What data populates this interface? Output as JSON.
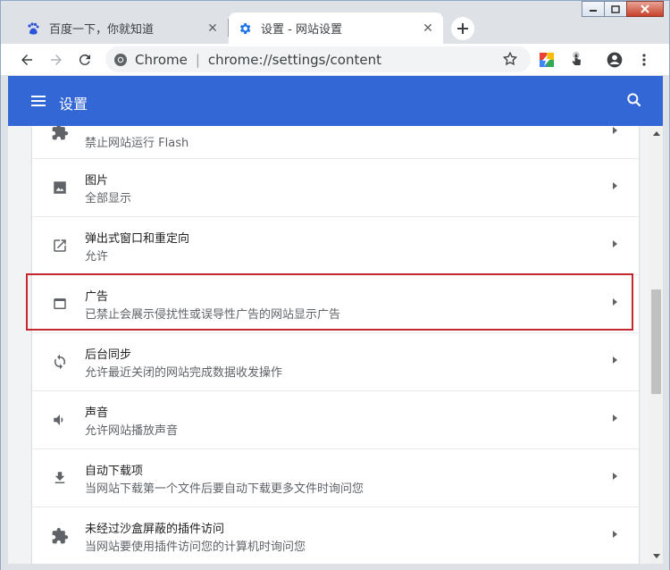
{
  "tabs": [
    {
      "title": "百度一下，你就知道",
      "icon": "baidu-paw-icon",
      "active": false
    },
    {
      "title": "设置 - 网站设置",
      "icon": "gear-icon",
      "active": true
    }
  ],
  "toolbar": {
    "site_chip": "Chrome",
    "divider": "|",
    "url": "chrome://settings/content"
  },
  "header": {
    "title": "设置"
  },
  "settings_rows": [
    {
      "title": "",
      "subtitle": "禁止网站运行 Flash",
      "icon": "puzzle-icon"
    },
    {
      "title": "图片",
      "subtitle": "全部显示",
      "icon": "image-icon"
    },
    {
      "title": "弹出式窗口和重定向",
      "subtitle": "允许",
      "icon": "open-in-new-icon"
    },
    {
      "title": "广告",
      "subtitle": "已禁止会展示侵扰性或误导性广告的网站显示广告",
      "icon": "web-asset-icon"
    },
    {
      "title": "后台同步",
      "subtitle": "允许最近关闭的网站完成数据收发操作",
      "icon": "sync-icon"
    },
    {
      "title": "声音",
      "subtitle": "允许网站播放声音",
      "icon": "volume-icon"
    },
    {
      "title": "自动下载项",
      "subtitle": "当网站下载第一个文件后要自动下载更多文件时询问您",
      "icon": "download-icon"
    },
    {
      "title": "未经过沙盒屏蔽的插件访问",
      "subtitle": "当网站要使用插件访问您的计算机时询问您",
      "icon": "puzzle-icon"
    }
  ],
  "colors": {
    "header_blue": "#3367d6",
    "highlight_red": "#c6282f"
  }
}
